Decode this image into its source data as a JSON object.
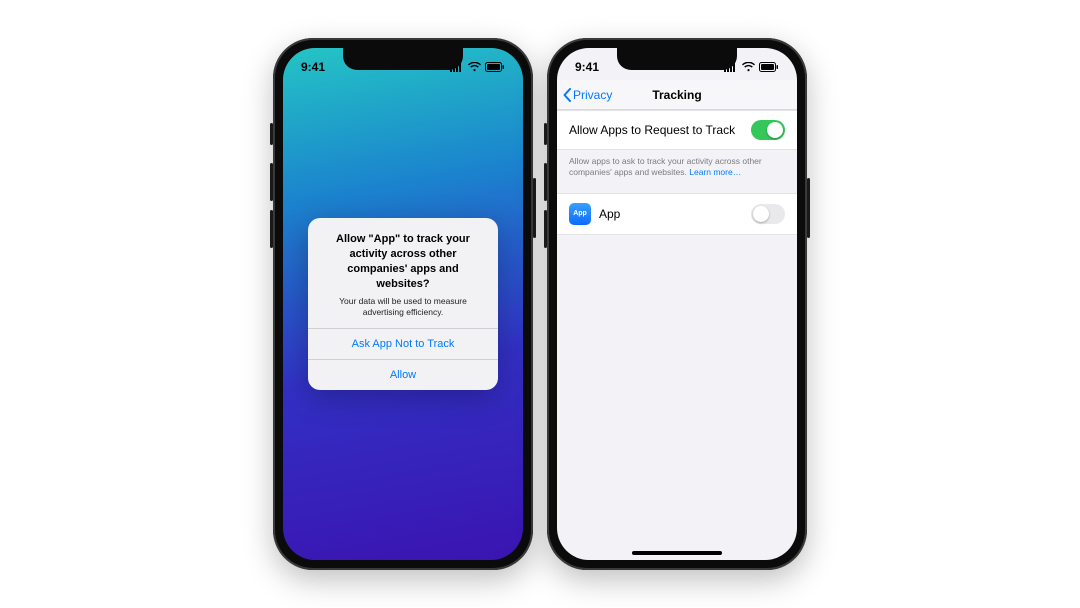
{
  "status": {
    "time": "9:41"
  },
  "left_phone": {
    "alert": {
      "title": "Allow \"App\" to track your activity across other companies' apps and websites?",
      "message": "Your data will be used to measure advertising efficiency.",
      "deny_label": "Ask App Not to Track",
      "allow_label": "Allow"
    }
  },
  "right_phone": {
    "nav": {
      "back_label": "Privacy",
      "title": "Tracking"
    },
    "master_toggle": {
      "label": "Allow Apps to Request to Track",
      "on": true
    },
    "footer": {
      "text": "Allow apps to ask to track your activity across other companies' apps and websites. ",
      "link": "Learn more…"
    },
    "apps": [
      {
        "icon_text": "App",
        "name": "App",
        "on": false
      }
    ]
  }
}
